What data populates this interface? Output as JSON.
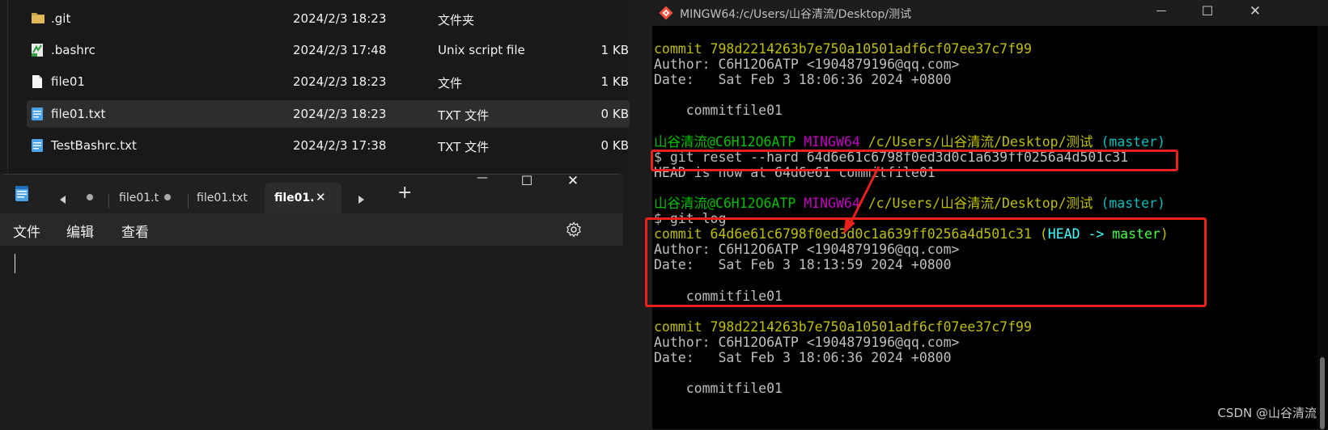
{
  "explorer": {
    "files": [
      {
        "name": ".git",
        "date": "2024/2/3 18:23",
        "type": "文件夹",
        "size": "",
        "icon": "folder-icon",
        "selected": false
      },
      {
        "name": ".bashrc",
        "date": "2024/2/3 17:48",
        "type": "Unix script file",
        "size": "1 KB",
        "icon": "script-file-icon",
        "selected": false
      },
      {
        "name": "file01",
        "date": "2024/2/3 18:23",
        "type": "文件",
        "size": "1 KB",
        "icon": "blank-file-icon",
        "selected": false
      },
      {
        "name": "file01.txt",
        "date": "2024/2/3 18:23",
        "type": "TXT 文件",
        "size": "0 KB",
        "icon": "text-file-icon",
        "selected": true
      },
      {
        "name": "TestBashrc.txt",
        "date": "2024/2/3 17:38",
        "type": "TXT 文件",
        "size": "0 KB",
        "icon": "text-file-icon",
        "selected": false
      }
    ]
  },
  "notepad": {
    "tabs": [
      {
        "label": "file01.t",
        "active": false
      },
      {
        "label": "file01.txt",
        "active": false
      },
      {
        "label": "file01.",
        "active": true
      }
    ],
    "menu": {
      "file": "文件",
      "edit": "编辑",
      "view": "查看"
    },
    "controls": {
      "minimize": "—",
      "maximize": "☐",
      "close": "✕",
      "add_tab": "+",
      "tab_close": "✕"
    }
  },
  "terminal": {
    "title": "MINGW64:/c/Users/山谷清流/Desktop/测试",
    "lines": [
      [
        {
          "t": "commit 798d2214263b7e750a10501adf6cf07ee37c7f99",
          "c": "c-yel"
        }
      ],
      [
        {
          "t": "Author: C6H12O6ATP <1904879196@qq.com>",
          "c": "c-wht"
        }
      ],
      [
        {
          "t": "Date:   Sat Feb 3 18:06:36 2024 +0800",
          "c": "c-wht"
        }
      ],
      [
        {
          "t": "",
          "c": "c-wht"
        }
      ],
      [
        {
          "t": "    commitfile01",
          "c": "c-wht"
        }
      ],
      [
        {
          "t": "",
          "c": "c-wht"
        }
      ],
      [
        {
          "t": "山谷清流@C6H12O6ATP ",
          "c": "c-grn"
        },
        {
          "t": "MINGW64 ",
          "c": "c-mag"
        },
        {
          "t": "/c/Users/山谷清流/Desktop/测试",
          "c": "c-yel"
        },
        {
          "t": " (master)",
          "c": "c-cyn"
        }
      ],
      [
        {
          "t": "$ git reset --hard 64d6e61c6798f0ed3d0c1a639ff0256a4d501c31",
          "c": "c-wht"
        }
      ],
      [
        {
          "t": "HEAD is now at 64d6e61 commitfile01",
          "c": "c-wht"
        }
      ],
      [
        {
          "t": "",
          "c": "c-wht"
        }
      ],
      [
        {
          "t": "山谷清流@C6H12O6ATP ",
          "c": "c-grn"
        },
        {
          "t": "MINGW64 ",
          "c": "c-mag"
        },
        {
          "t": "/c/Users/山谷清流/Desktop/测试",
          "c": "c-yel"
        },
        {
          "t": " (master)",
          "c": "c-cyn"
        }
      ],
      [
        {
          "t": "$ git log",
          "c": "c-wht"
        }
      ],
      [
        {
          "t": "commit 64d6e61c6798f0ed3d0c1a639ff0256a4d501c31 ",
          "c": "c-yel"
        },
        {
          "t": "(",
          "c": "c-yel"
        },
        {
          "t": "HEAD -> ",
          "c": "c-bcy"
        },
        {
          "t": "master",
          "c": "c-bgr"
        },
        {
          "t": ")",
          "c": "c-yel"
        }
      ],
      [
        {
          "t": "Author: C6H12O6ATP <1904879196@qq.com>",
          "c": "c-wht"
        }
      ],
      [
        {
          "t": "Date:   Sat Feb 3 18:13:59 2024 +0800",
          "c": "c-wht"
        }
      ],
      [
        {
          "t": "",
          "c": "c-wht"
        }
      ],
      [
        {
          "t": "    commitfile01",
          "c": "c-wht"
        }
      ],
      [
        {
          "t": "",
          "c": "c-wht"
        }
      ],
      [
        {
          "t": "commit 798d2214263b7e750a10501adf6cf07ee37c7f99",
          "c": "c-yel"
        }
      ],
      [
        {
          "t": "Author: C6H12O6ATP <1904879196@qq.com>",
          "c": "c-wht"
        }
      ],
      [
        {
          "t": "Date:   Sat Feb 3 18:06:36 2024 +0800",
          "c": "c-wht"
        }
      ],
      [
        {
          "t": "",
          "c": "c-wht"
        }
      ],
      [
        {
          "t": "    commitfile01",
          "c": "c-wht"
        }
      ]
    ],
    "controls": {
      "minimize": "—",
      "maximize": "☐",
      "close": "✕"
    }
  },
  "watermark": "CSDN @山谷清流",
  "colors": {
    "annotation": "#e8211b"
  }
}
